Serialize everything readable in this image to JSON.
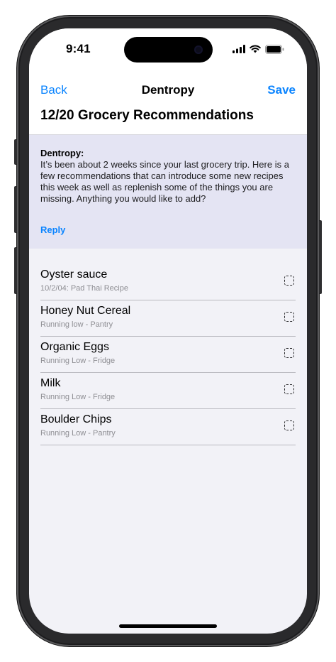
{
  "status_bar": {
    "time": "9:41",
    "icons": [
      "cellular-signal-icon",
      "wifi-icon",
      "battery-icon"
    ]
  },
  "nav": {
    "back_label": "Back",
    "title": "Dentropy",
    "save_label": "Save"
  },
  "page": {
    "title": "12/20 Grocery Recommendations"
  },
  "message": {
    "sender": "Dentropy:",
    "body": "It’s been about 2 weeks since your last grocery trip. Here is a few recommendations that can introduce some new recipes this week as well as replenish some of the things you are missing. Anything you would like to add?",
    "reply_label": "Reply"
  },
  "items": [
    {
      "name": "Oyster sauce",
      "note": "10/2/04: Pad Thai Recipe",
      "checked": false
    },
    {
      "name": "Honey Nut Cereal",
      "note": "Running low - Pantry",
      "checked": false
    },
    {
      "name": "Organic Eggs",
      "note": "Running Low - Fridge",
      "checked": false
    },
    {
      "name": "Milk",
      "note": "Running Low - Fridge",
      "checked": false
    },
    {
      "name": "Boulder Chips",
      "note": "Running Low - Pantry",
      "checked": false
    }
  ],
  "colors": {
    "accent": "#0a84ff",
    "message_background": "#e4e4f3",
    "screen_background": "#f2f2f7",
    "frame": "#1c1c1e"
  }
}
